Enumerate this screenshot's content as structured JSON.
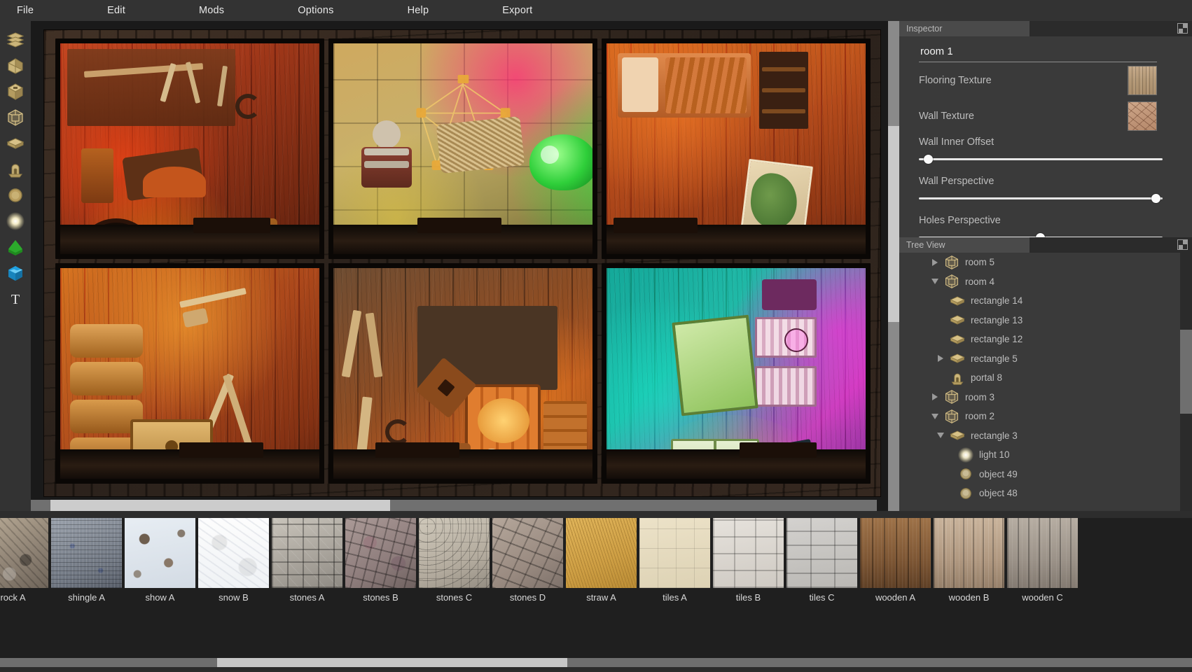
{
  "app": {
    "window_background": "#2d2d2d"
  },
  "menubar": {
    "items": [
      {
        "label": "File"
      },
      {
        "label": "Edit"
      },
      {
        "label": "Mods"
      },
      {
        "label": "Options"
      },
      {
        "label": "Help"
      },
      {
        "label": "Export"
      }
    ]
  },
  "toolbar": {
    "tools": [
      {
        "name": "layers-icon",
        "tooltip": "Layers"
      },
      {
        "name": "house-icon",
        "tooltip": "House"
      },
      {
        "name": "cube-icon",
        "tooltip": "Cube"
      },
      {
        "name": "room-icon",
        "tooltip": "Room"
      },
      {
        "name": "rectangle-icon",
        "tooltip": "Rectangle"
      },
      {
        "name": "portal-icon",
        "tooltip": "Portal"
      },
      {
        "name": "object-icon",
        "tooltip": "Object"
      },
      {
        "name": "light-icon",
        "tooltip": "Light"
      },
      {
        "name": "terrain-green-icon",
        "tooltip": "Terrain"
      },
      {
        "name": "water-blue-icon",
        "tooltip": "Water"
      },
      {
        "name": "text-icon",
        "tooltip": "Text",
        "glyph": "T"
      }
    ]
  },
  "inspector": {
    "panel_title": "Inspector",
    "expand_icon": "expand-icon",
    "object_name": "room 1",
    "properties": [
      {
        "label": "Flooring Texture",
        "type": "texture",
        "swatch": "wood-planks"
      },
      {
        "label": "Wall Texture",
        "type": "texture",
        "swatch": "cracked-clay"
      }
    ],
    "sliders": [
      {
        "label": "Wall Inner Offset",
        "value_percent": 2
      },
      {
        "label": "Wall Perspective",
        "value_percent": 97
      },
      {
        "label": "Holes Perspective",
        "value_percent": 50
      }
    ]
  },
  "treeview": {
    "panel_title": "Tree View",
    "expand_icon": "expand-icon",
    "nodes": [
      {
        "label": "room 5",
        "icon": "room-icon",
        "depth": 1,
        "twisty": "collapsed"
      },
      {
        "label": "room 4",
        "icon": "room-icon",
        "depth": 1,
        "twisty": "expanded"
      },
      {
        "label": "rectangle 14",
        "icon": "rectangle-icon",
        "depth": 2,
        "twisty": "none"
      },
      {
        "label": "rectangle 13",
        "icon": "rectangle-icon",
        "depth": 2,
        "twisty": "none"
      },
      {
        "label": "rectangle 12",
        "icon": "rectangle-icon",
        "depth": 2,
        "twisty": "none"
      },
      {
        "label": "rectangle 5",
        "icon": "rectangle-icon",
        "depth": 2,
        "twisty": "collapsed"
      },
      {
        "label": "portal 8",
        "icon": "portal-icon",
        "depth": 2,
        "twisty": "none"
      },
      {
        "label": "room 3",
        "icon": "room-icon",
        "depth": 1,
        "twisty": "collapsed"
      },
      {
        "label": "room 2",
        "icon": "room-icon",
        "depth": 1,
        "twisty": "expanded"
      },
      {
        "label": "rectangle 3",
        "icon": "rectangle-icon",
        "depth": 2,
        "twisty": "expanded"
      },
      {
        "label": "light 10",
        "icon": "light-icon",
        "depth": 3,
        "twisty": "none"
      },
      {
        "label": "object 49",
        "icon": "object-icon",
        "depth": 3,
        "twisty": "none"
      },
      {
        "label": "object 48",
        "icon": "object-icon",
        "depth": 3,
        "twisty": "none"
      }
    ]
  },
  "viewport": {
    "name": "3d-scene-viewport",
    "rooms": [
      {
        "name": "room-cell-1",
        "accent": "#c4441f"
      },
      {
        "name": "room-cell-2",
        "accent": "#cfa95f"
      },
      {
        "name": "room-cell-3",
        "accent": "#d9681f"
      },
      {
        "name": "room-cell-4",
        "accent": "#d5701f"
      },
      {
        "name": "room-cell-5",
        "accent": "#b0521f"
      },
      {
        "name": "room-cell-6",
        "accent": "#1fb7a4"
      }
    ]
  },
  "palette": {
    "name": "texture-palette",
    "textures": [
      {
        "label": "rock A",
        "css": "t-rockA"
      },
      {
        "label": "shingle A",
        "css": "t-shingleA"
      },
      {
        "label": "show A",
        "css": "t-showA"
      },
      {
        "label": "snow B",
        "css": "t-snowB"
      },
      {
        "label": "stones A",
        "css": "t-stonesA"
      },
      {
        "label": "stones B",
        "css": "t-stonesB"
      },
      {
        "label": "stones C",
        "css": "t-stonesC"
      },
      {
        "label": "stones D",
        "css": "t-stonesD"
      },
      {
        "label": "straw A",
        "css": "t-strawA"
      },
      {
        "label": "tiles A",
        "css": "t-tilesA"
      },
      {
        "label": "tiles B",
        "css": "t-tilesB"
      },
      {
        "label": "tiles C",
        "css": "t-tilesC"
      },
      {
        "label": "wooden A",
        "css": "t-woodenA"
      },
      {
        "label": "wooden B",
        "css": "t-woodenB"
      },
      {
        "label": "wooden C",
        "css": "t-woodenC"
      }
    ]
  },
  "colors": {
    "menubar_bg": "#333333",
    "panel_bg": "#3a3a3a",
    "app_bg": "#2b2b2b",
    "text_primary": "#f2f2f2",
    "text_secondary": "#bdbdbd",
    "scrollbar_thumb": "#cccccc"
  }
}
